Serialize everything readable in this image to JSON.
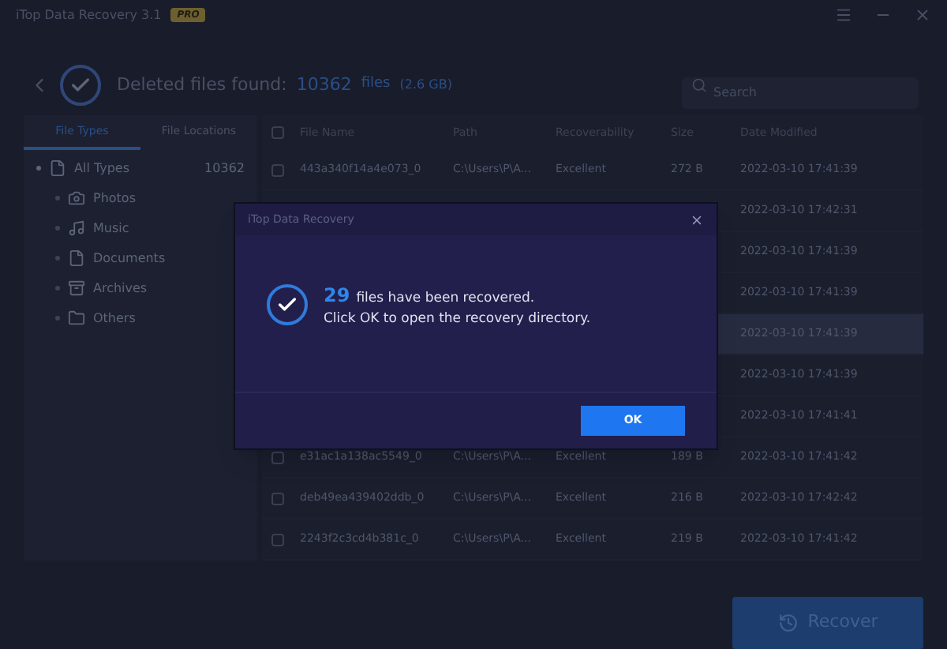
{
  "window": {
    "title": "iTop Data Recovery 3.1",
    "badge": "PRO"
  },
  "header": {
    "label": "Deleted files found:",
    "count": "10362",
    "unit": "files",
    "size": "(2.6 GB)"
  },
  "search": {
    "placeholder": "Search"
  },
  "tabs": [
    {
      "label": "File Types",
      "selected": true
    },
    {
      "label": "File Locations",
      "selected": false
    }
  ],
  "tree": [
    {
      "label": "All Types",
      "count": "10362",
      "kind": "all",
      "expanded": true,
      "children": [
        {
          "label": "Photos",
          "kind": "photos"
        },
        {
          "label": "Music",
          "kind": "music"
        },
        {
          "label": "Documents",
          "kind": "documents"
        },
        {
          "label": "Archives",
          "kind": "archives"
        },
        {
          "label": "Others",
          "kind": "others"
        }
      ]
    }
  ],
  "table": {
    "select_all": {
      "checked": false
    },
    "columns": [
      "File Name",
      "Path",
      "Recoverability",
      "Size",
      "Date Modified"
    ],
    "rows": [
      {
        "checked": false,
        "cells": [
          "443a340f14a4e073_0",
          "C:\\Users\\P\\A...",
          "Excellent",
          "272 B",
          "2022-03-10 17:41:39"
        ],
        "highlighted": false
      },
      {
        "cells": [
          "",
          "",
          "",
          "",
          "2022-03-10 17:42:31"
        ],
        "highlighted": false
      },
      {
        "cells": [
          "",
          "",
          "",
          "",
          "2022-03-10 17:41:39"
        ],
        "highlighted": false
      },
      {
        "cells": [
          "",
          "",
          "",
          "",
          "2022-03-10 17:41:39"
        ],
        "highlighted": false
      },
      {
        "cells": [
          "",
          "",
          "",
          "",
          "2022-03-10 17:41:39"
        ],
        "highlighted": true
      },
      {
        "cells": [
          "",
          "",
          "",
          "",
          "2022-03-10 17:41:39"
        ],
        "highlighted": false
      },
      {
        "cells": [
          "",
          "",
          "",
          "",
          "2022-03-10 17:41:41"
        ],
        "highlighted": false
      },
      {
        "checked": false,
        "cells": [
          "e31ac1a138ac5549_0",
          "C:\\Users\\P\\A...",
          "Excellent",
          "189 B",
          "2022-03-10 17:41:42"
        ],
        "highlighted": false
      },
      {
        "checked": false,
        "cells": [
          "deb49ea439402ddb_0",
          "C:\\Users\\P\\A...",
          "Excellent",
          "216 B",
          "2022-03-10 17:42:42"
        ],
        "highlighted": false
      },
      {
        "checked": false,
        "cells": [
          "2243f2c3cd4b381c_0",
          "C:\\Users\\P\\A...",
          "Excellent",
          "219 B",
          "2022-03-10 17:41:42"
        ],
        "highlighted": false
      }
    ]
  },
  "recover_button": {
    "label": "Recover"
  },
  "dialog": {
    "title": "iTop Data Recovery",
    "count": "29",
    "line1": "files have been recovered.",
    "line2": "Click OK to open the recovery directory.",
    "button": "OK"
  }
}
